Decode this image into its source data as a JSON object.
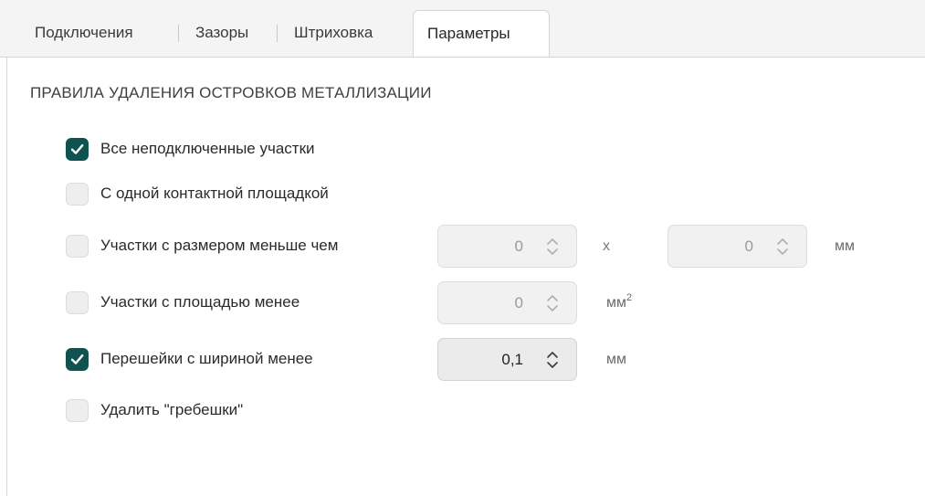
{
  "tabs": [
    {
      "label": "Подключения",
      "active": false
    },
    {
      "label": "Зазоры",
      "active": false
    },
    {
      "label": "Штриховка",
      "active": false
    },
    {
      "label": "Параметры",
      "active": true
    }
  ],
  "section_title": "ПРАВИЛА УДАЛЕНИЯ ОСТРОВКОВ МЕТАЛЛИЗАЦИИ",
  "options": {
    "all_unconnected": {
      "label": "Все неподключенные участки",
      "checked": true
    },
    "single_pad": {
      "label": "С одной контактной площадкой",
      "checked": false
    },
    "size_less": {
      "label": "Участки с размером меньше чем",
      "checked": false,
      "value_x": "0",
      "value_y": "0",
      "separator": "x",
      "unit": "мм"
    },
    "area_less": {
      "label": "Участки с площадью менее",
      "checked": false,
      "value": "0",
      "unit": "мм",
      "unit_sup": "2"
    },
    "neck_width": {
      "label": "Перешейки с шириной менее",
      "checked": true,
      "value": "0,1",
      "unit": "мм"
    },
    "remove_combs": {
      "label": "Удалить \"гребешки\"",
      "checked": false
    }
  },
  "colors": {
    "accent": "#0f5350"
  },
  "icons": {
    "check": "check-icon",
    "spinner": "spinner-arrows-icon"
  }
}
